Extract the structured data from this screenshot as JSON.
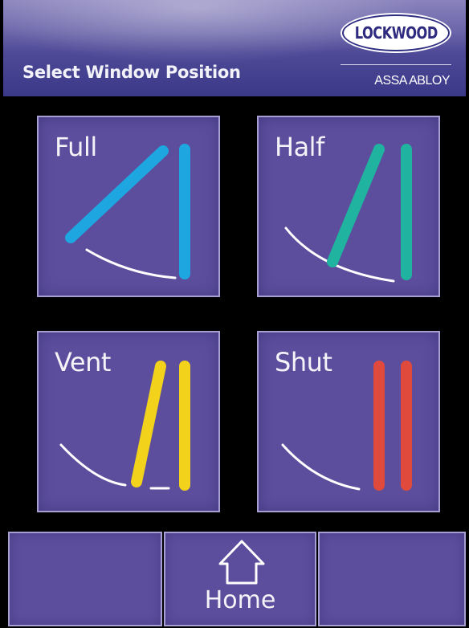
{
  "header": {
    "title": "Select Window Position",
    "logo_text": "LOCKWOOD",
    "logo_sub": "ASSA ABLOY"
  },
  "positions": [
    {
      "label": "Full",
      "color": "#1ea6e0",
      "icon": "window-full-open-icon"
    },
    {
      "label": "Half",
      "color": "#1fb3a0",
      "icon": "window-half-open-icon"
    },
    {
      "label": "Vent",
      "color": "#f2d21a",
      "icon": "window-vent-open-icon"
    },
    {
      "label": "Shut",
      "color": "#e04a3c",
      "icon": "window-shut-icon"
    }
  ],
  "footer": {
    "home_label": "Home",
    "home_icon": "home-icon"
  },
  "colors": {
    "button_fill": "#5c4e9d",
    "button_border": "#a79fd2",
    "background": "#000000"
  }
}
